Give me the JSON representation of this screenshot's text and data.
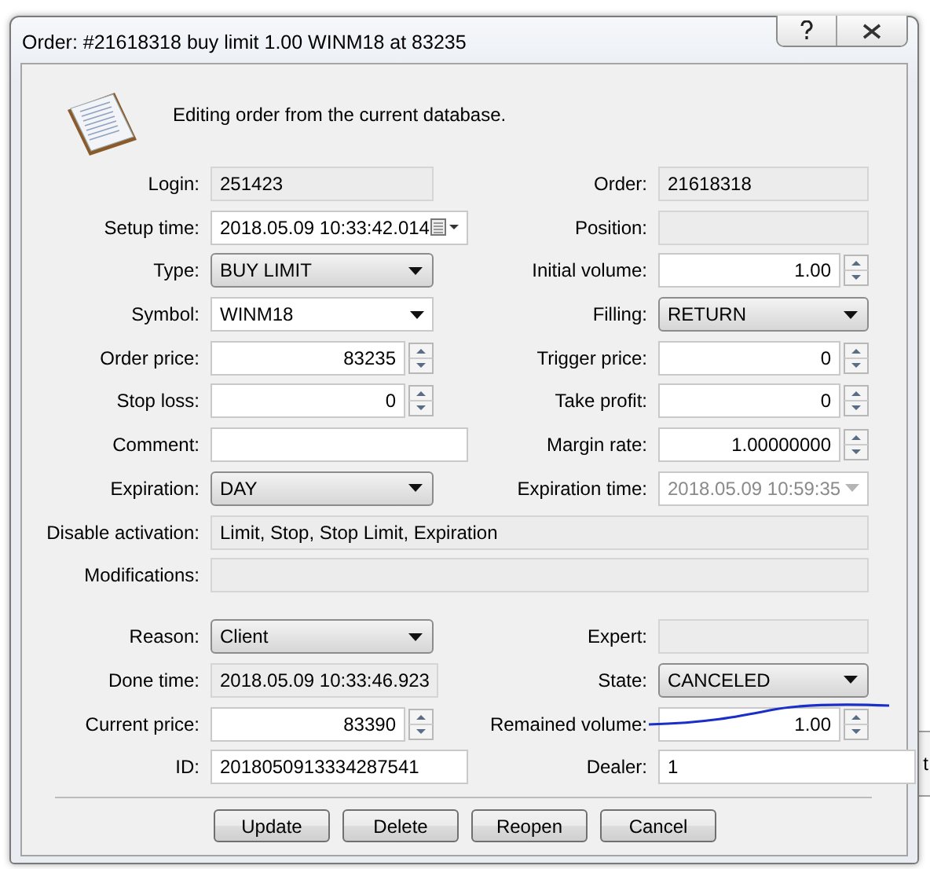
{
  "window": {
    "title": "Order: #21618318 buy limit 1.00 WINM18 at 83235"
  },
  "header": {
    "message": "Editing order from the current database."
  },
  "top_rows": [
    {
      "left": {
        "label": "Login:",
        "value": "251423",
        "kind": "readonly"
      },
      "right": {
        "label": "Order:",
        "value": "21618318",
        "kind": "readonly"
      }
    },
    {
      "left": {
        "label": "Setup time:",
        "value": "2018.05.09 10:33:42.014",
        "kind": "date"
      },
      "right": {
        "label": "Position:",
        "kind": "readonly"
      }
    },
    {
      "left": {
        "label": "Type:",
        "value": "BUY LIMIT",
        "kind": "dropdown"
      },
      "right": {
        "label": "Initial volume:",
        "value": "1.00",
        "kind": "spin"
      }
    },
    {
      "left": {
        "label": "Symbol:",
        "value": "WINM18",
        "kind": "combo"
      },
      "right": {
        "label": "Filling:",
        "value": "RETURN",
        "kind": "dropdown"
      }
    },
    {
      "left": {
        "label": "Order price:",
        "value": "83235",
        "kind": "spin"
      },
      "right": {
        "label": "Trigger price:",
        "value": "0",
        "kind": "spin"
      }
    },
    {
      "left": {
        "label": "Stop loss:",
        "value": "0",
        "kind": "spin"
      },
      "right": {
        "label": "Take profit:",
        "value": "0",
        "kind": "spin"
      }
    },
    {
      "left": {
        "label": "Comment:",
        "kind": "text"
      },
      "right": {
        "label": "Margin rate:",
        "value": "1.00000000",
        "kind": "spin"
      }
    },
    {
      "left": {
        "label": "Expiration:",
        "value": "DAY",
        "kind": "dropdown"
      },
      "right": {
        "label": "Expiration time:",
        "value": "2018.05.09 10:59:35",
        "kind": "disabled_dropdown"
      }
    },
    {
      "wide": {
        "label": "Disable activation:",
        "value": "Limit, Stop, Stop Limit, Expiration",
        "kind": "readonly"
      }
    },
    {
      "wide": {
        "label": "Modifications:",
        "kind": "readonly"
      }
    }
  ],
  "bottom_rows": [
    {
      "left": {
        "label": "Reason:",
        "value": "Client",
        "kind": "dropdown"
      },
      "right": {
        "label": "Expert:",
        "kind": "readonly"
      }
    },
    {
      "left": {
        "label": "Done time:",
        "value": "2018.05.09 10:33:46.923",
        "kind": "readonly"
      },
      "right": {
        "label": "State:",
        "value": "CANCELED",
        "kind": "dropdown"
      }
    },
    {
      "left": {
        "label": "Current price:",
        "value": "83390",
        "kind": "spin"
      },
      "right": {
        "label": "Remained volume:",
        "value": "1.00",
        "kind": "spin"
      }
    },
    {
      "left": {
        "label": "ID:",
        "value": "2018050913334287541",
        "kind": "text"
      },
      "right": {
        "label": "Dealer:",
        "value": "1",
        "kind": "text"
      }
    }
  ],
  "buttons": [
    "Update",
    "Delete",
    "Reopen",
    "Cancel"
  ],
  "background_window": {
    "text": "t"
  }
}
